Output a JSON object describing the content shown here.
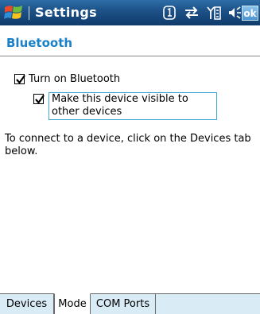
{
  "titlebar": {
    "app_title": "Settings",
    "ok_label": "ok",
    "status_icons": [
      "sim-card-icon",
      "connectivity-icon",
      "signal-icon",
      "volume-icon"
    ],
    "start_icon": "windows-logo-icon"
  },
  "page": {
    "heading": "Bluetooth",
    "heading_color": "#1a80c7"
  },
  "options": {
    "turn_on_label": "Turn on Bluetooth",
    "turn_on_checked": true,
    "visible_label": "Make this device visible to other devices",
    "visible_checked": true
  },
  "info": {
    "text": "To connect to a device, click on the Devices tab below."
  },
  "tabs": {
    "items": [
      {
        "label": "Devices"
      },
      {
        "label": "Mode",
        "selected": true
      },
      {
        "label": "COM Ports"
      }
    ]
  }
}
